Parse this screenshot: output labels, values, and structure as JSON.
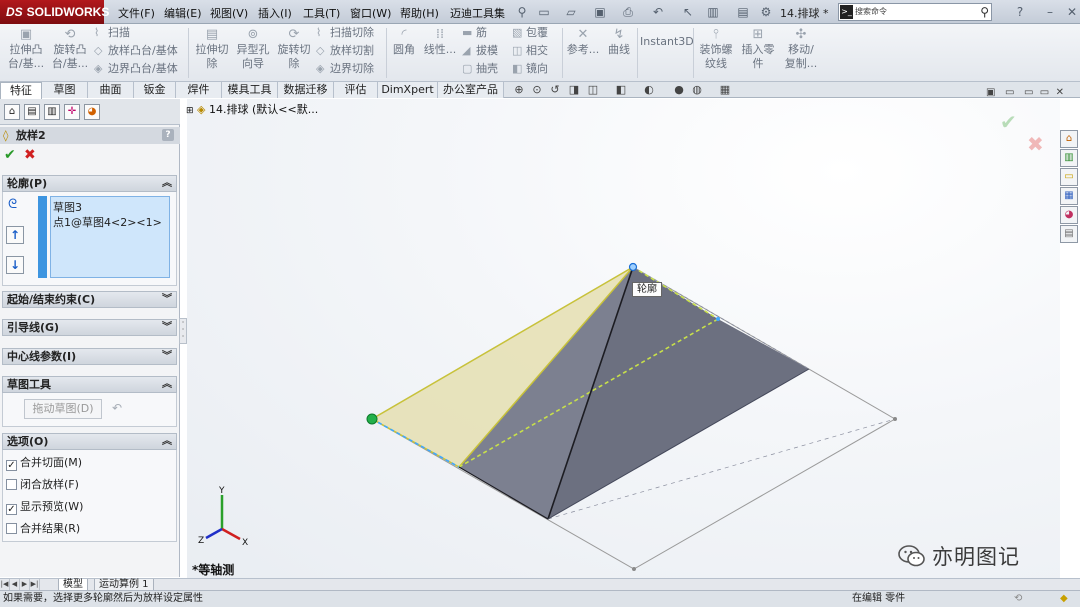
{
  "app": {
    "logo": "SOLIDWORKS",
    "logo_mark": "DS"
  },
  "menu": [
    "文件(F)",
    "编辑(E)",
    "视图(V)",
    "插入(I)",
    "工具(T)",
    "窗口(W)",
    "帮助(H)",
    "迈迪工具集"
  ],
  "document_title": "14.排球 *",
  "search": {
    "placeholder": "搜索命令"
  },
  "ribbon": {
    "extrude_boss": "拉伸凸\n台/基...",
    "revolve_boss": "旋转凸\n台/基...",
    "sweep": "扫描",
    "loft_boss": "放样凸台/基体",
    "boundary_boss": "边界凸台/基体",
    "extrude_cut": "拉伸切\n除",
    "hole_wizard": "异型孔\n向导",
    "revolve_cut": "旋转切\n除",
    "sweep_cut": "扫描切除",
    "loft_cut": "放样切割",
    "boundary_cut": "边界切除",
    "fillet": "圆角",
    "linear_pattern": "线性...",
    "rib": "筋",
    "draft": "拔模",
    "shell": "抽壳",
    "wrap": "包覆",
    "intersect": "相交",
    "mirror": "镜向",
    "reference": "参考...",
    "curves": "曲线",
    "instant3d": "Instant3D",
    "cosmetic_thread": "装饰螺\n纹线",
    "insert_part": "插入零\n件",
    "move_copy": "移动/\n复制..."
  },
  "tabs": [
    "特征",
    "草图",
    "曲面",
    "钣金",
    "焊件",
    "模具工具",
    "数据迁移",
    "评估",
    "DimXpert",
    "办公室产品"
  ],
  "property_manager": {
    "title": "放样2",
    "help": "?",
    "groups": {
      "profile": "轮廓(P)",
      "start_end": "起始/结束约束(C)",
      "guide": "引导线(G)",
      "centerline": "中心线参数(I)",
      "sketch_tools": "草图工具",
      "options": "选项(O)"
    },
    "profiles": [
      "草图3",
      "点1@草图4<2><1>"
    ],
    "drag_sketch": "拖动草图(D)",
    "options": [
      {
        "label": "合并切面(M)",
        "checked": true
      },
      {
        "label": "闭合放样(F)",
        "checked": false
      },
      {
        "label": "显示预览(W)",
        "checked": true
      },
      {
        "label": "合并结果(R)",
        "checked": false
      }
    ]
  },
  "viewport": {
    "tree_node": "14.排球 (默认<<默...",
    "callout": "轮廓",
    "view_orientation": "*等轴测",
    "watermark": "亦明图记",
    "colors": {
      "loft_face_yellow": "#e8e3b8",
      "loft_face_dark": "#6a6e7e",
      "dashed_profile": "#3fa8ff",
      "accent": "#00a0ff"
    }
  },
  "bottom_tabs": [
    "模型",
    "运动算例 1"
  ],
  "status": {
    "left": "如果需要，选择更多轮廓然后为放样设定属性",
    "mode": "在编辑 零件"
  }
}
